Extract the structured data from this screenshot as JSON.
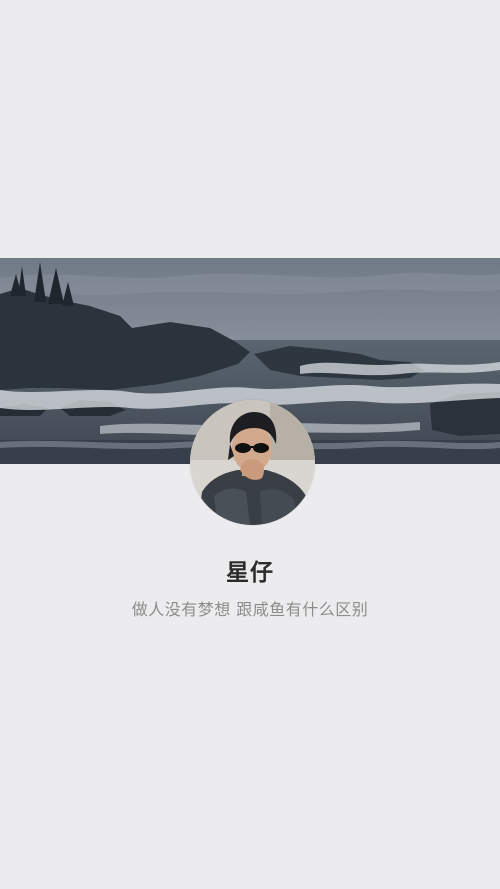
{
  "profile": {
    "name": "星仔",
    "signature": "做人没有梦想 跟咸鱼有什么区别"
  },
  "icons": {
    "cover": "seascape-photo",
    "avatar": "person-with-sunglasses-photo"
  },
  "colors": {
    "background": "#ececee",
    "name_text": "#2b2b2b",
    "signature_text": "#8c8c8c"
  }
}
